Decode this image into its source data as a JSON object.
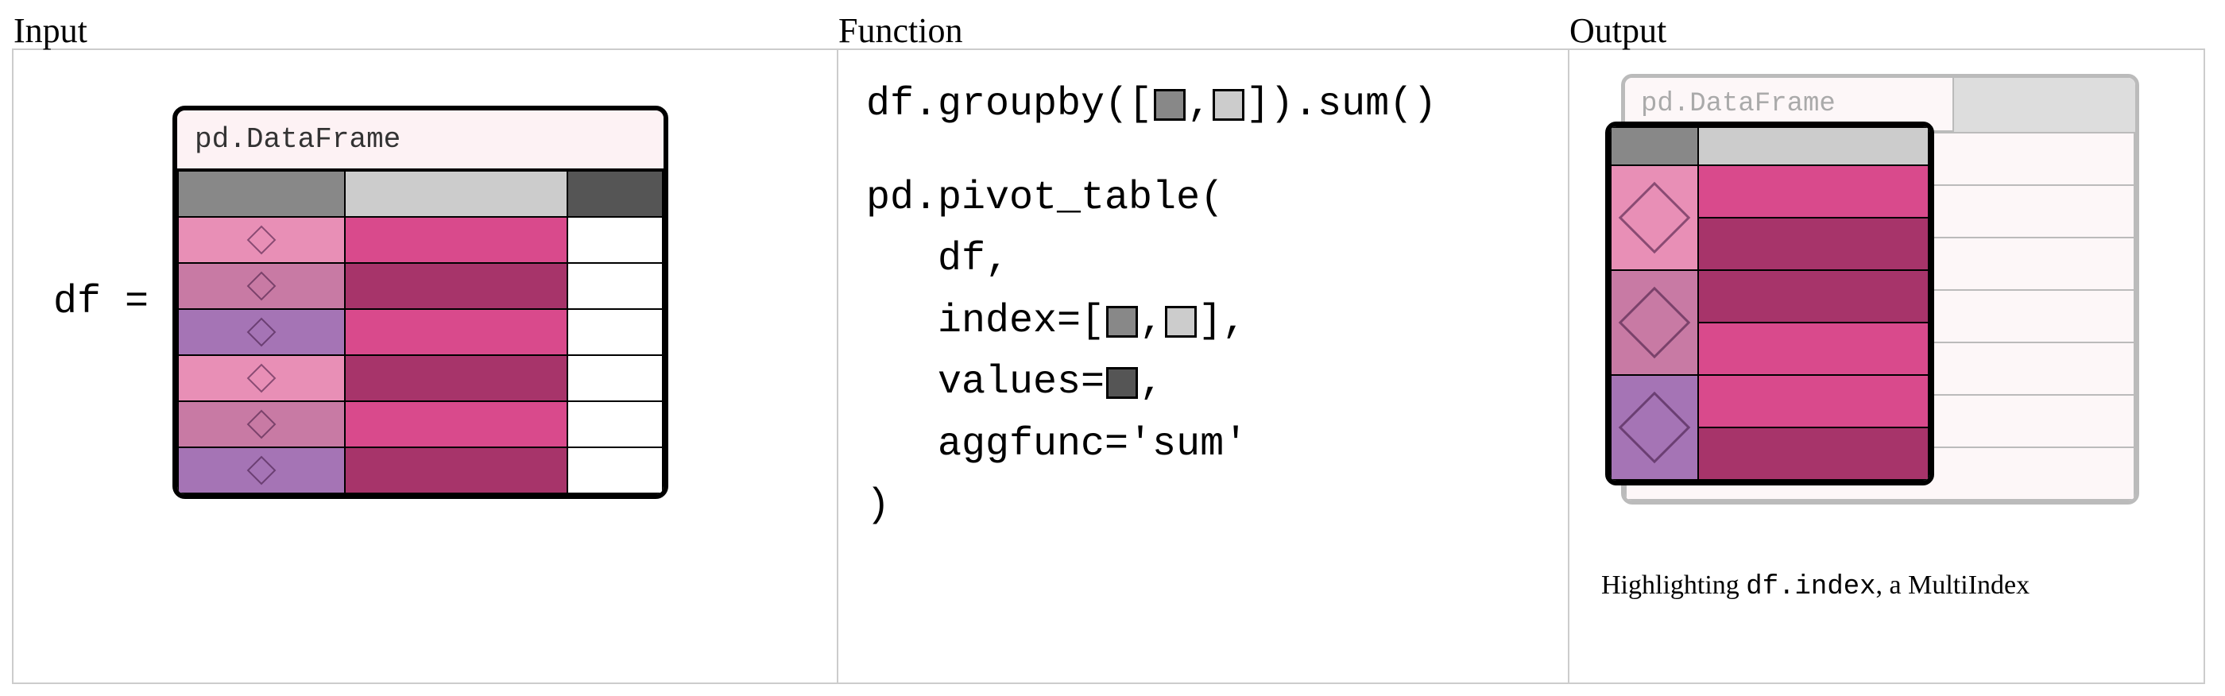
{
  "labels": {
    "input": "Input",
    "function": "Function",
    "output": "Output"
  },
  "input": {
    "var_assign": "df = ",
    "type_label": "pd.DataFrame",
    "header_colors": [
      "hdr-dark",
      "hdr-light",
      "hdr-darker"
    ],
    "rows": [
      {
        "index_color": "pink1",
        "value_color": "mag1"
      },
      {
        "index_color": "pink2",
        "value_color": "mag2"
      },
      {
        "index_color": "purple1",
        "value_color": "mag1"
      },
      {
        "index_color": "pink1",
        "value_color": "mag2"
      },
      {
        "index_color": "pink2",
        "value_color": "mag1"
      },
      {
        "index_color": "purple1",
        "value_color": "mag2"
      }
    ]
  },
  "function": {
    "groupby_pre": "df.groupby([",
    "groupby_sep": ",",
    "groupby_post": "]).sum()",
    "pivot_open": "pd.pivot_table(",
    "pivot_df": "   df,",
    "pivot_index_pre": "   index=[",
    "pivot_index_sep": ",",
    "pivot_index_post": "],",
    "pivot_values_pre": "   values=",
    "pivot_values_post": ",",
    "pivot_aggfunc": "   aggfunc='sum'",
    "pivot_close": ")"
  },
  "output": {
    "type_label": "pd.DataFrame",
    "ghost_rows": 7,
    "index_groups": [
      {
        "index_color": "pink1",
        "values": [
          "mag1",
          "mag2"
        ]
      },
      {
        "index_color": "pink2",
        "values": [
          "mag2",
          "mag1"
        ]
      },
      {
        "index_color": "purple1",
        "values": [
          "mag1",
          "mag2"
        ]
      }
    ],
    "caption_pre": "Highlighting ",
    "caption_code": "df.index",
    "caption_post": ", a MultiIndex"
  },
  "colors": {
    "hdr-dark": "#888888",
    "hdr-light": "#cccccc",
    "hdr-darker": "#555555",
    "pink1": "#e88fb6",
    "pink2": "#c87aa4",
    "purple1": "#a574b5",
    "mag1": "#d94a8c",
    "mag2": "#a7346a"
  }
}
